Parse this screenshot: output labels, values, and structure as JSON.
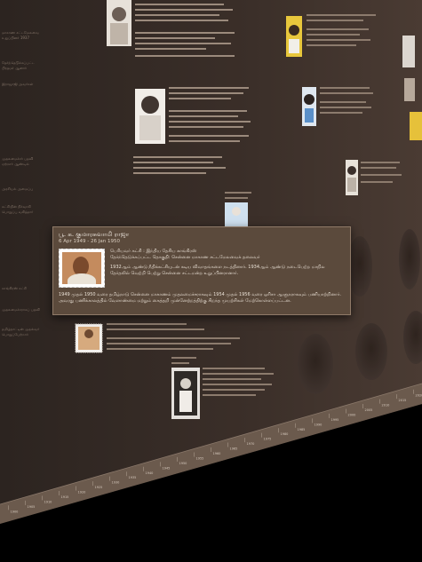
{
  "popup": {
    "title": "பூ. க. குமாரசுவாமி ராஜா",
    "dates": "6 Apr 1949 - 26 Jan 1950",
    "lines": [
      "பெரியவர் கட்சி : இந்திய தேசிய காங்கிரஸ்",
      "தேர்ந்தெடுக்கப்பட்ட தொகுதி: சென்னை மாகாண சட்டமேலவைக் தலைவர்"
    ],
    "body1": "1932ஆம் ஆண்டு நீதிக்கட்சியுடன் கடிய விவாதங்களை நடத்தினார். 1934ஆம் ஆண்டு நடைபெற்ற மாநில தேர்தலில் வெற்றி பெற்று சென்னை சட்டமன்ற உறுப்பினரானார்.",
    "body2": "1949 முதல் 1950 வரை தமிழ்நாடு சென்னை மாகாணம் முதலமைச்சராகவும் 1954 முதல் 1956 வரை ஒரிசா ஆளுநராகவும் பணியாற்றினார். அவரது பணிக்காலத்தில் வேளாண்மை மற்றும் கைத்தறி முன்னேற்றத்திற்கு சிறந்த முயற்சிகள் மேற்கொள்ளப்பட்டன."
  },
  "ruler_labels": [
    "1900",
    "1905",
    "1910",
    "1915",
    "1920",
    "1925",
    "1930",
    "1935",
    "1940",
    "1945",
    "1950",
    "1955",
    "1960",
    "1965",
    "1970",
    "1975",
    "1980",
    "1985",
    "1990",
    "1995",
    "2000",
    "2005",
    "2010",
    "2015",
    "2020"
  ]
}
